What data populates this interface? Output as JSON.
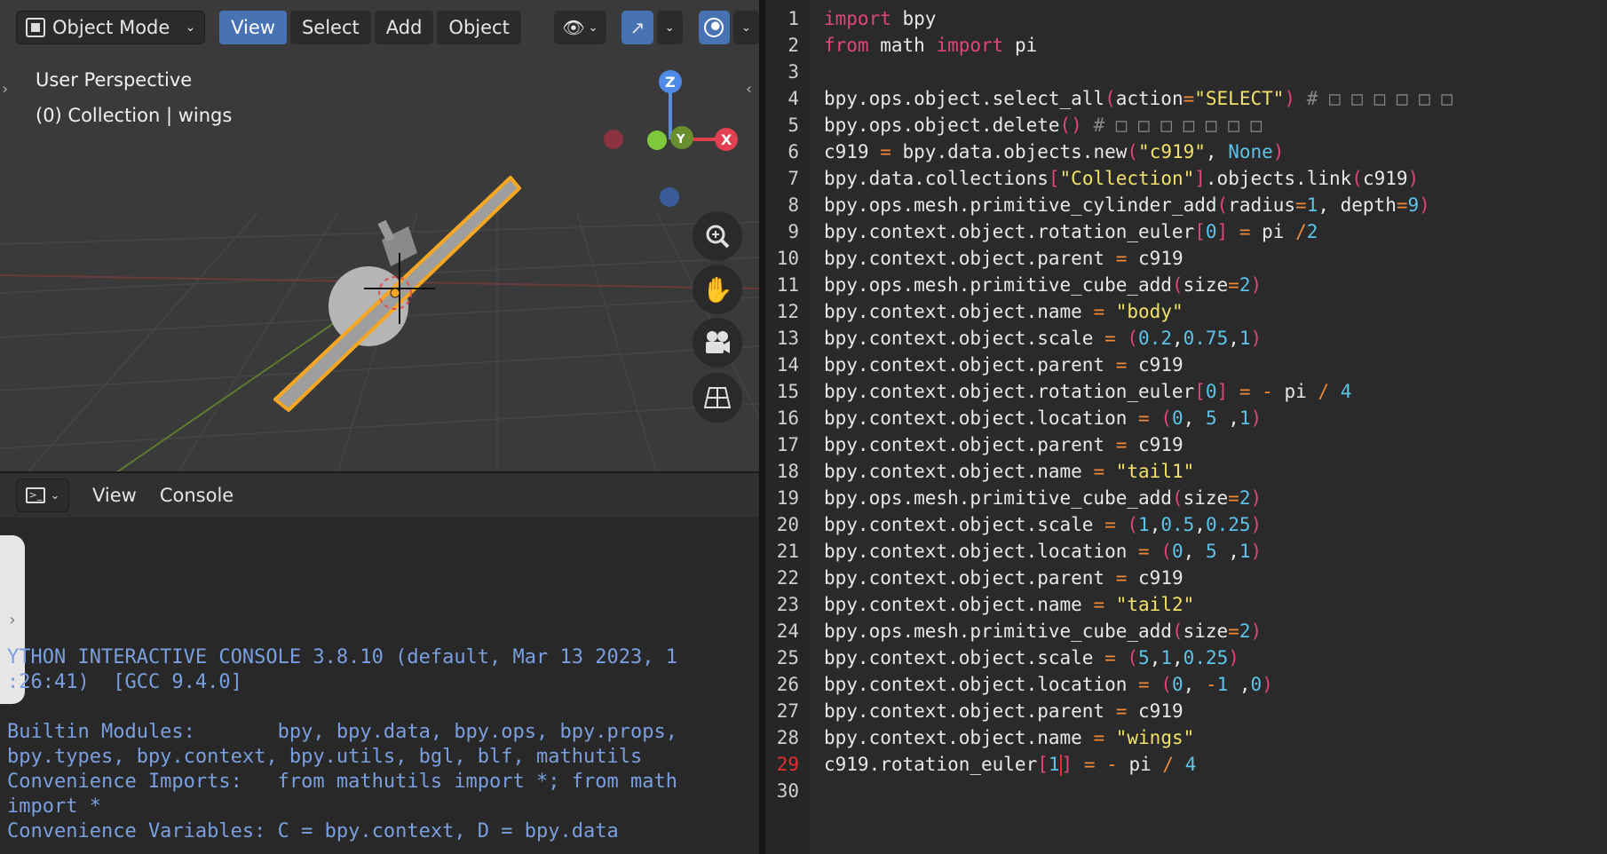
{
  "viewport": {
    "mode_label": "Object Mode",
    "menus": [
      "View",
      "Select",
      "Add",
      "Object"
    ],
    "active_menu": "View",
    "perspective_label": "User Perspective",
    "collection_label": "(0) Collection | wings",
    "gizmo": {
      "z": "Z",
      "y": "Y",
      "x": "X"
    },
    "nav_icons": [
      "zoom-icon",
      "hand-pan-icon",
      "camera-icon",
      "grid-ortho-icon"
    ]
  },
  "console": {
    "menus": [
      "View",
      "Console"
    ],
    "lines": [
      "YTHON INTERACTIVE CONSOLE 3.8.10 (default, Mar 13 2023, 1",
      ":26:41)  [GCC 9.4.0]",
      "",
      "Builtin Modules:       bpy, bpy.data, bpy.ops, bpy.props,",
      "bpy.types, bpy.context, bpy.utils, bgl, blf, mathutils",
      "Convenience Imports:   from mathutils import *; from math",
      "import *",
      "Convenience Variables: C = bpy.context, D = bpy.data"
    ]
  },
  "editor": {
    "current_line": 29,
    "line_numbers": [
      "1",
      "2",
      "3",
      "4",
      "5",
      "6",
      "7",
      "8",
      "9",
      "10",
      "11",
      "12",
      "13",
      "14",
      "15",
      "16",
      "17",
      "18",
      "19",
      "20",
      "21",
      "22",
      "23",
      "24",
      "25",
      "26",
      "27",
      "28",
      "29",
      "30"
    ],
    "code": [
      "import bpy",
      "from math import pi",
      "",
      "bpy.ops.object.select_all(action=\"SELECT\") # □ □ □ □ □ □",
      "bpy.ops.object.delete() # □ □ □ □ □ □ □",
      "c919 = bpy.data.objects.new(\"c919\", None)",
      "bpy.data.collections[\"Collection\"].objects.link(c919)",
      "bpy.ops.mesh.primitive_cylinder_add(radius=1, depth=9)",
      "bpy.context.object.rotation_euler[0] = pi /2",
      "bpy.context.object.parent = c919",
      "bpy.ops.mesh.primitive_cube_add(size=2)",
      "bpy.context.object.name = \"body\"",
      "bpy.context.object.scale = (0.2,0.75,1)",
      "bpy.context.object.parent = c919",
      "bpy.context.object.rotation_euler[0] = - pi / 4",
      "bpy.context.object.location = (0, 5 ,1)",
      "bpy.context.object.parent = c919",
      "bpy.context.object.name = \"tail1\"",
      "bpy.ops.mesh.primitive_cube_add(size=2)",
      "bpy.context.object.scale = (1,0.5,0.25)",
      "bpy.context.object.location = (0, 5 ,1)",
      "bpy.context.object.parent = c919",
      "bpy.context.object.name = \"tail2\"",
      "bpy.ops.mesh.primitive_cube_add(size=2)",
      "bpy.context.object.scale = (5,1,0.25)",
      "bpy.context.object.location = (0, -1 ,0)",
      "bpy.context.object.parent = c919",
      "bpy.context.object.name = \"wings\"",
      "c919.rotation_euler[1] = - pi / 4",
      ""
    ]
  }
}
